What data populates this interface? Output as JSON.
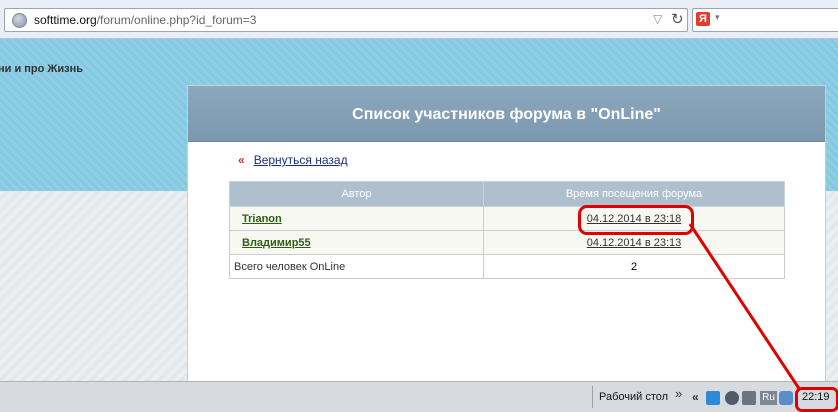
{
  "browser": {
    "url_host": "softtime.org",
    "url_rest": "/forum/online.php?id_forum=3",
    "search_engine_letter": "Я"
  },
  "page": {
    "tagline": "ни и про Жизнь",
    "panel_title": "Список участников форума в \"OnLine\"",
    "back_arrows": "«",
    "back_link": "Вернуться назад",
    "table": {
      "headers": [
        "Автор",
        "Время посещения форума"
      ],
      "rows": [
        {
          "author": "Trianon",
          "time": "04.12.2014 в 23:18"
        },
        {
          "author": "Владимир55",
          "time": "04.12.2014 в 23:13"
        }
      ],
      "total_label": "Всего человек OnLine",
      "total_value": "2"
    }
  },
  "taskbar": {
    "desktop_label": "Рабочий стол",
    "desktop_chevron": "»",
    "tray_chevron": "«",
    "lang": "Ru",
    "clock": "22:19"
  },
  "colors": {
    "annotation": "#e00000",
    "header_band": "#8da8bd",
    "user_link": "#2d5f10"
  }
}
